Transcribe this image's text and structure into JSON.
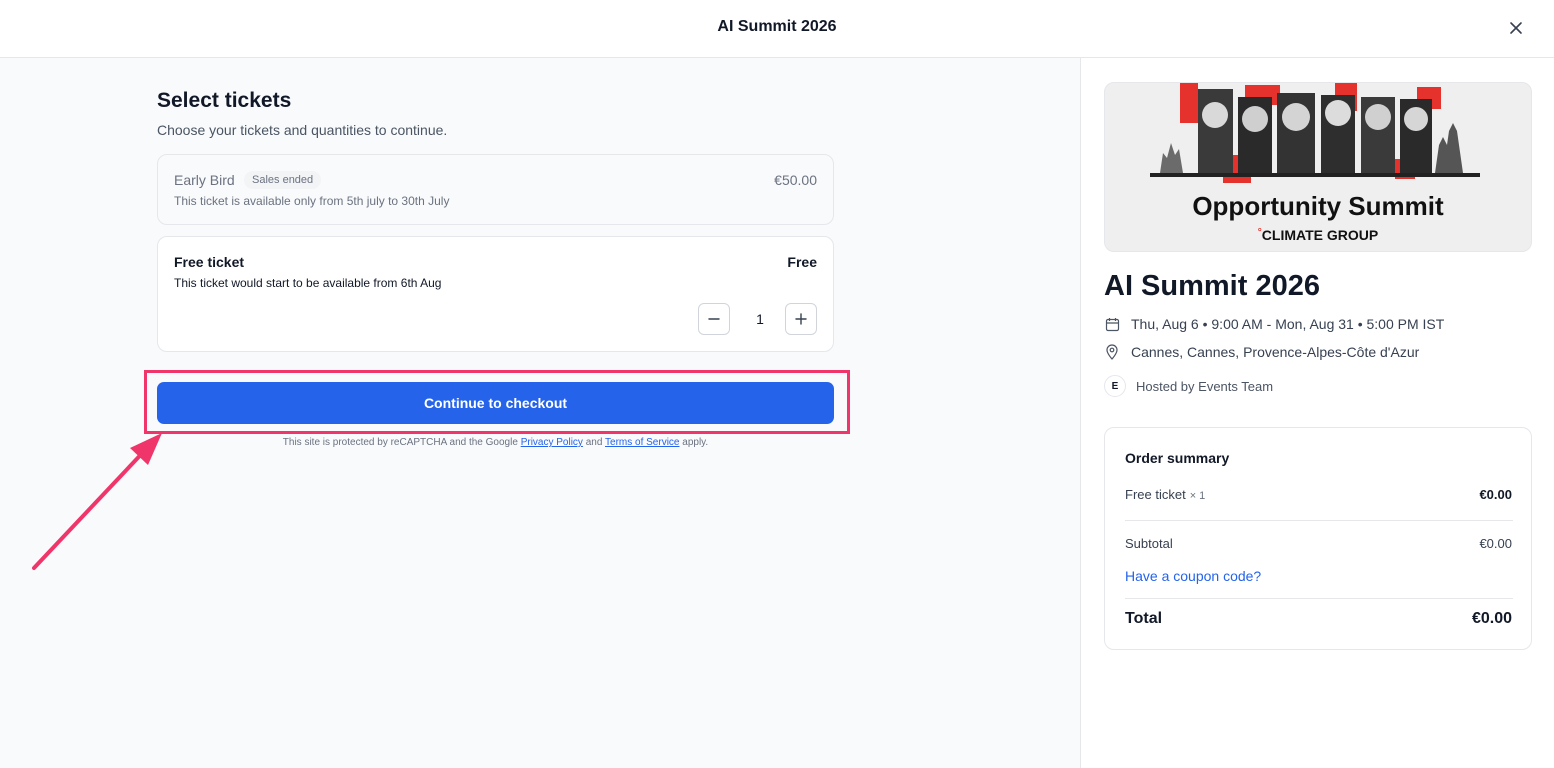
{
  "header": {
    "title": "AI Summit 2026",
    "close_icon": "close-icon"
  },
  "tickets": {
    "heading": "Select tickets",
    "subheading": "Choose your tickets and quantities to continue.",
    "items": [
      {
        "name": "Early Bird",
        "badge": "Sales ended",
        "description": "This ticket is available only from 5th july to 30th July",
        "price": "€50.00"
      },
      {
        "name": "Free ticket",
        "description": "This ticket would start to be available from 6th Aug",
        "price": "Free",
        "quantity": "1"
      }
    ],
    "continue_label": "Continue to checkout",
    "legal": {
      "prefix": "This site is protected by reCAPTCHA and the Google",
      "privacy": "Privacy Policy",
      "and": "and",
      "terms": "Terms of Service",
      "suffix": "apply."
    }
  },
  "event": {
    "banner_title": "Opportunity Summit",
    "banner_sub": "CLIMATE GROUP",
    "banner_sub_mark": "°",
    "title": "AI Summit 2026",
    "date": "Thu, Aug 6 • 9:00 AM - Mon, Aug 31 • 5:00 PM IST",
    "location": "Cannes, Cannes, Provence-Alpes-Côte d'Azur",
    "host_initial": "E",
    "host": "Hosted by Events Team"
  },
  "order_summary": {
    "title": "Order summary",
    "line_item": "Free ticket",
    "line_qty": "× 1",
    "line_amount": "€0.00",
    "subtotal_label": "Subtotal",
    "subtotal_value": "€0.00",
    "coupon_label": "Have a coupon code?",
    "total_label": "Total",
    "total_value": "€0.00"
  },
  "colors": {
    "accent": "#2563eb",
    "highlight": "#f0356a",
    "banner_red": "#e5322d"
  }
}
